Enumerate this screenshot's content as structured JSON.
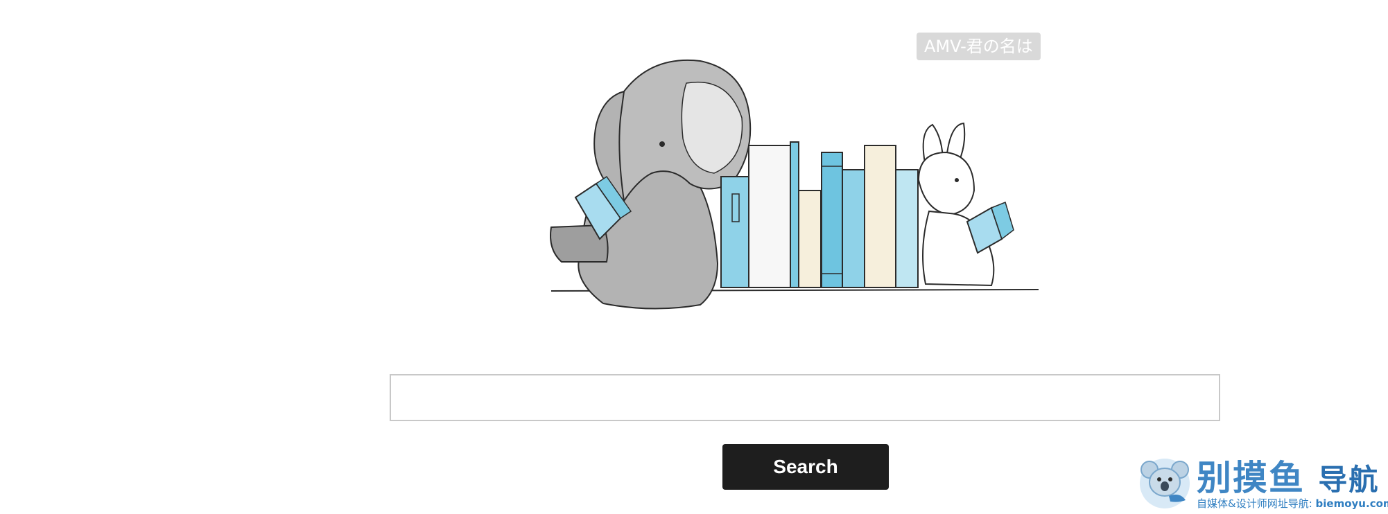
{
  "badge": {
    "text": "AMV-君の名は"
  },
  "illustration": {
    "icon": "elephant-rabbit-bookshelf-illustration",
    "colors": {
      "elephant": "#a9a9a9",
      "book_blue": "#7dcbe3",
      "book_light": "#bfe6f2",
      "book_cream": "#f6efdc",
      "outline": "#2b2b2b"
    }
  },
  "search": {
    "placeholder": "",
    "value": "",
    "button_label": "Search"
  },
  "watermark": {
    "title": "别摸鱼",
    "title_suffix": "导航",
    "subtitle": "自媒体&设计师网址导航:",
    "domain": "biemoyu.com",
    "color": "#3f86c4"
  }
}
